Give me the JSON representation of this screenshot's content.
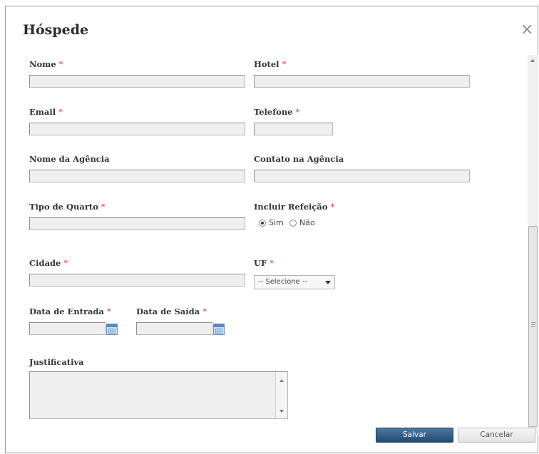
{
  "dialog": {
    "title": "Hóspede",
    "close_symbol": "×"
  },
  "required_mark": "*",
  "fields": {
    "nome": {
      "label": "Nome",
      "value": ""
    },
    "hotel": {
      "label": "Hotel",
      "value": ""
    },
    "email": {
      "label": "Email",
      "value": ""
    },
    "telefone": {
      "label": "Telefone",
      "value": ""
    },
    "nome_agencia": {
      "label": "Nome da Agência",
      "value": ""
    },
    "contato_agencia": {
      "label": "Contato na Agência",
      "value": ""
    },
    "tipo_quarto": {
      "label": "Tipo de Quarto",
      "value": ""
    },
    "incluir_refeicao": {
      "label": "Incluir Refeição",
      "options": [
        "Sim",
        "Não"
      ],
      "selected": "Sim"
    },
    "cidade": {
      "label": "Cidade",
      "value": ""
    },
    "uf": {
      "label": "UF",
      "selected": "-- Selecione --"
    },
    "data_entrada": {
      "label": "Data de Entrada",
      "value": ""
    },
    "data_saida": {
      "label": "Data de Saída",
      "value": ""
    },
    "justificativa": {
      "label": "Justificativa",
      "value": ""
    }
  },
  "buttons": {
    "save": "Salvar",
    "cancel": "Cancelar"
  },
  "icons": {
    "calendar": "calendar-icon",
    "close": "close-icon"
  },
  "colors": {
    "required": "#e0323a",
    "primary_button": "#2f5a82"
  }
}
